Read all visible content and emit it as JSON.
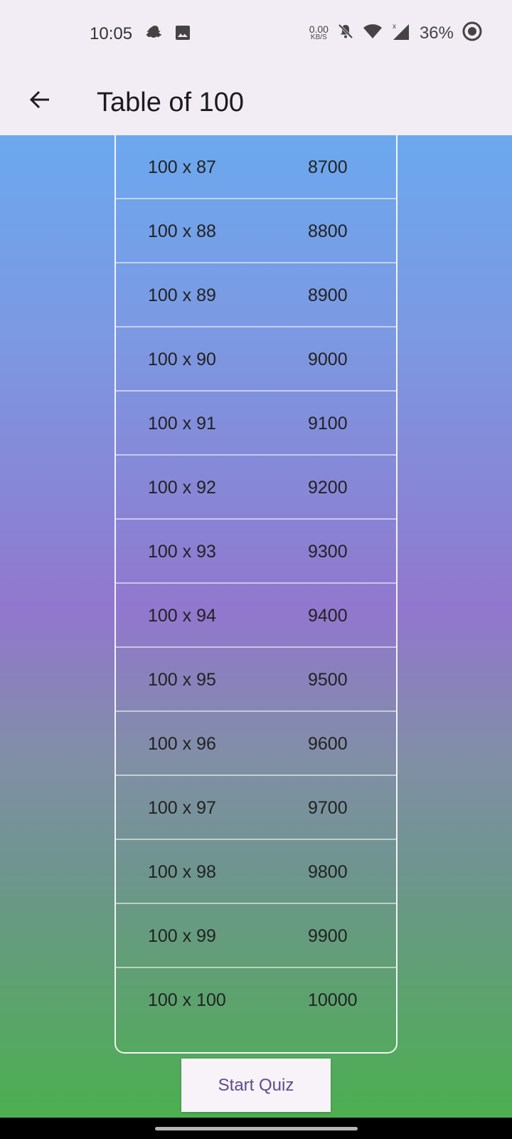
{
  "status_bar": {
    "time": "10:05",
    "net_speed_value": "0.00",
    "net_speed_unit": "KB/S",
    "battery": "36%"
  },
  "app_bar": {
    "title": "Table of 100"
  },
  "table": {
    "rows": [
      {
        "expr": "100 x 87",
        "result": "8700"
      },
      {
        "expr": "100 x 88",
        "result": "8800"
      },
      {
        "expr": "100 x 89",
        "result": "8900"
      },
      {
        "expr": "100 x 90",
        "result": "9000"
      },
      {
        "expr": "100 x 91",
        "result": "9100"
      },
      {
        "expr": "100 x 92",
        "result": "9200"
      },
      {
        "expr": "100 x 93",
        "result": "9300"
      },
      {
        "expr": "100 x 94",
        "result": "9400"
      },
      {
        "expr": "100 x 95",
        "result": "9500"
      },
      {
        "expr": "100 x 96",
        "result": "9600"
      },
      {
        "expr": "100 x 97",
        "result": "9700"
      },
      {
        "expr": "100 x 98",
        "result": "9800"
      },
      {
        "expr": "100 x 99",
        "result": "9900"
      },
      {
        "expr": "100 x 100",
        "result": "10000"
      }
    ]
  },
  "actions": {
    "start_quiz_label": "Start Quiz"
  },
  "colors": {
    "accent": "#5f4b8b",
    "gradient_top": "#61b2f7",
    "gradient_mid": "#9177cd",
    "gradient_bottom": "#4caf50"
  }
}
